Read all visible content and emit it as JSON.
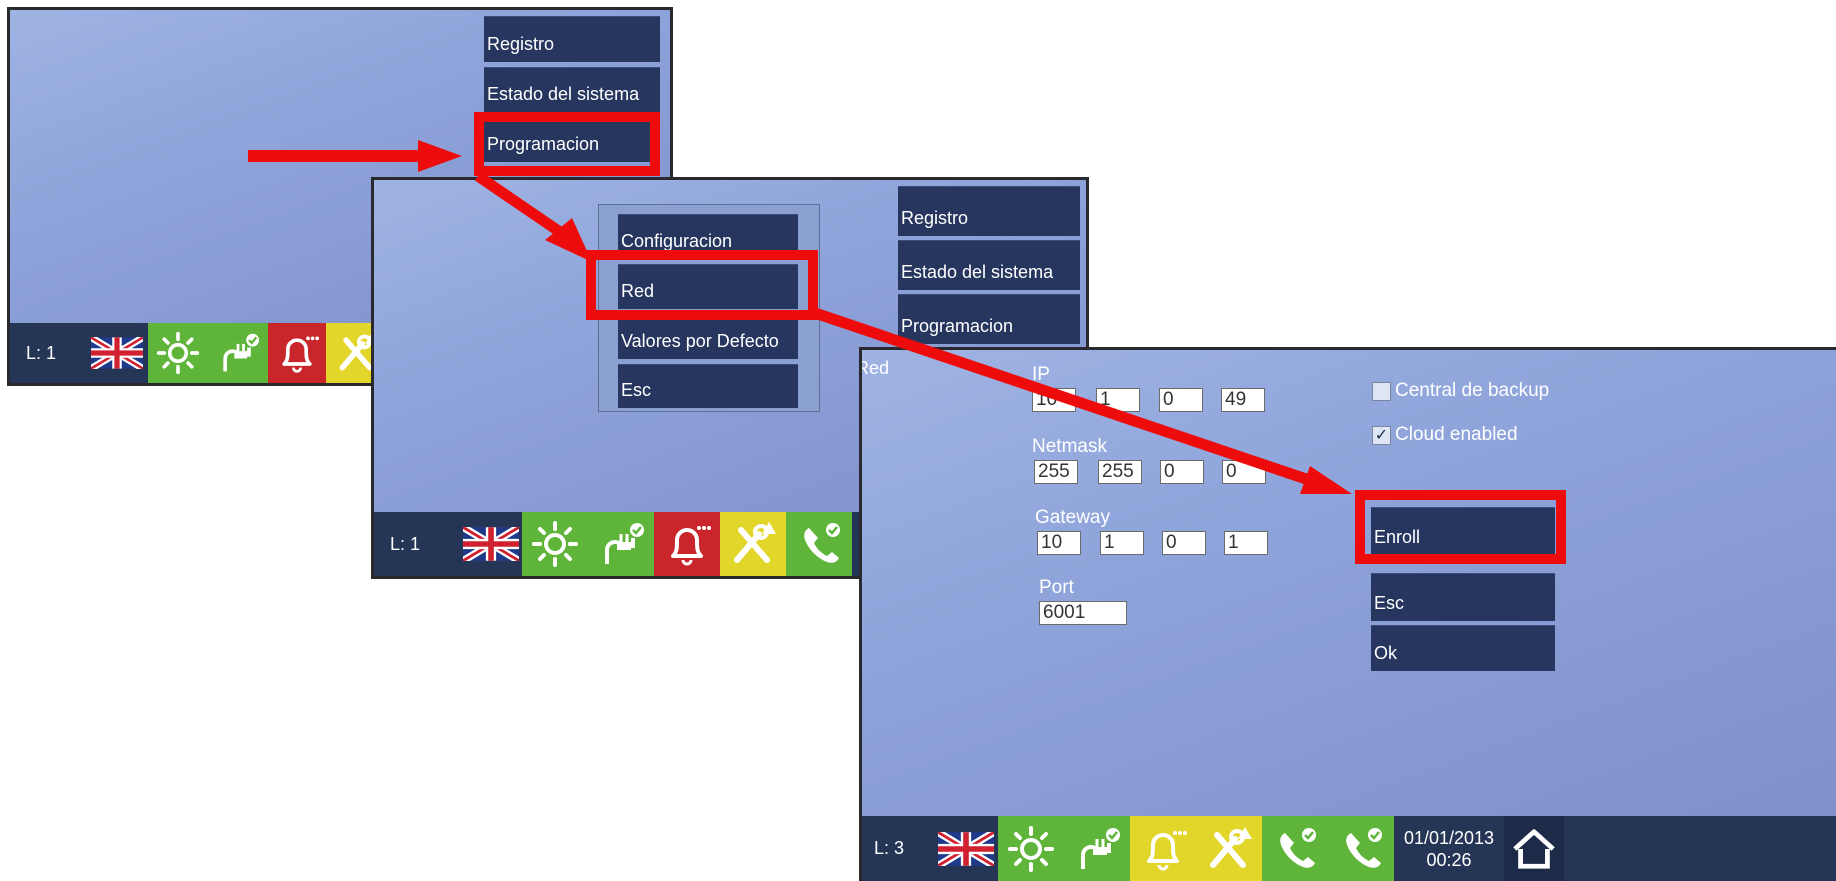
{
  "screen1": {
    "menu": [
      "Registro",
      "Estado del sistema",
      "Programacion"
    ],
    "level": "L: 1"
  },
  "screen2": {
    "submenu": [
      "Configuracion",
      "Red",
      "Valores por Defecto",
      "Esc"
    ],
    "menu": [
      "Registro",
      "Estado del sistema",
      "Programacion"
    ],
    "level": "L: 1"
  },
  "screen3": {
    "title": "Red",
    "ip_label": "IP",
    "ip": [
      "10",
      "1",
      "0",
      "49"
    ],
    "netmask_label": "Netmask",
    "netmask": [
      "255",
      "255",
      "0",
      "0"
    ],
    "gateway_label": "Gateway",
    "gateway": [
      "10",
      "1",
      "0",
      "1"
    ],
    "port_label": "Port",
    "port": "6001",
    "backup_label": "Central de backup",
    "backup_checked": false,
    "cloud_label": "Cloud enabled",
    "cloud_checked": true,
    "checkmark": "✓",
    "buttons": {
      "enroll": "Enroll",
      "esc": "Esc",
      "ok": "Ok"
    },
    "level": "L: 3",
    "date": "01/01/2013",
    "time": "00:26"
  },
  "colors": {
    "accent": "#ee0b0b",
    "button": "#26365e",
    "green": "#5fb43a",
    "red": "#c8262b",
    "yellow": "#e3d62a"
  },
  "icons": [
    "uk-flag-icon",
    "sun-icon",
    "plug-icon",
    "bell-icon",
    "tools-icon",
    "phone-icon",
    "home-icon"
  ]
}
